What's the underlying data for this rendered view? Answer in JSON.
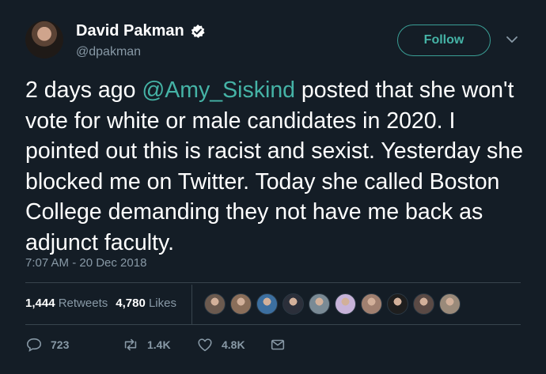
{
  "author": {
    "name": "David Pakman",
    "handle": "@dpakman",
    "verified": true
  },
  "follow_button": {
    "label": "Follow"
  },
  "tweet": {
    "text_before": "2 days ago ",
    "mention": "@Amy_Siskind",
    "text_after": " posted that she won't vote for white or male candidates in 2020. I pointed out this is racist and sexist. Yesterday she blocked me on Twitter. Today she called Boston College demanding they not have me back as adjunct faculty.",
    "timestamp": "7:07 AM - 20 Dec 2018"
  },
  "stats": {
    "retweets_count": "1,444",
    "retweets_label": "Retweets",
    "likes_count": "4,780",
    "likes_label": "Likes"
  },
  "likers": [
    {
      "color": "#6b5a4f"
    },
    {
      "color": "#8a6e5a"
    },
    {
      "color": "#3c6fa0"
    },
    {
      "color": "#2b2f3a"
    },
    {
      "color": "#7a8a95"
    },
    {
      "color": "#c7b3d9"
    },
    {
      "color": "#a08070"
    },
    {
      "color": "#1e1e1e"
    },
    {
      "color": "#5a4a45"
    },
    {
      "color": "#9a8a7a"
    }
  ],
  "actions": {
    "replies": "723",
    "retweets": "1.4K",
    "likes": "4.8K"
  },
  "colors": {
    "background": "#141d26",
    "accent": "#45b3a6",
    "secondary_text": "#8899a6"
  }
}
